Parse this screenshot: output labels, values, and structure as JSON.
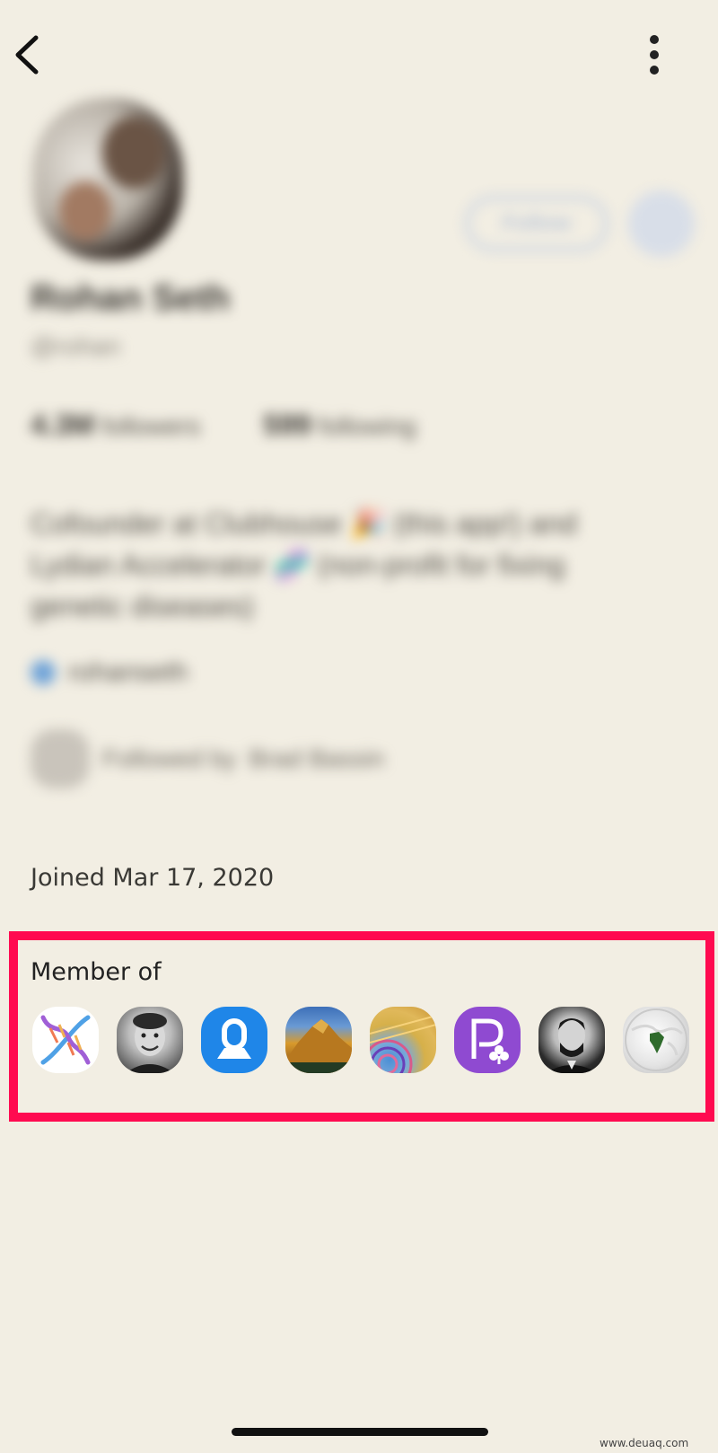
{
  "nav": {
    "back_icon": "chevron-left-icon",
    "more_icon": "vertical-dots-icon"
  },
  "profile": {
    "name": "Rohan Seth",
    "handle": "@rohan",
    "followers_count": "4.3M",
    "followers_label": "followers",
    "following_count": "599",
    "following_label": "following",
    "bio": "Cofounder at Clubhouse 🎉 (this app!) and Lydian Accelerator 🧬 (non-profit for fixing genetic diseases)",
    "twitter": "rohanseth",
    "followed_by_prefix": "Followed by",
    "followed_by_name": "Brad Bassin",
    "follow_button": "Follow"
  },
  "joined": "Joined Mar 17, 2020",
  "member_of": {
    "title": "Member of",
    "clubs": [
      {
        "icon": "dna-icon"
      },
      {
        "icon": "man-portrait-icon"
      },
      {
        "icon": "keyhole-logo-icon"
      },
      {
        "icon": "mountain-icon"
      },
      {
        "icon": "pattern-icon"
      },
      {
        "icon": "p-club-icon"
      },
      {
        "icon": "lincoln-portrait-icon"
      },
      {
        "icon": "globe-icon"
      }
    ]
  },
  "watermark": "www.deuaq.com",
  "colors": {
    "background": "#f2eee3",
    "highlight": "#ff0a50"
  }
}
